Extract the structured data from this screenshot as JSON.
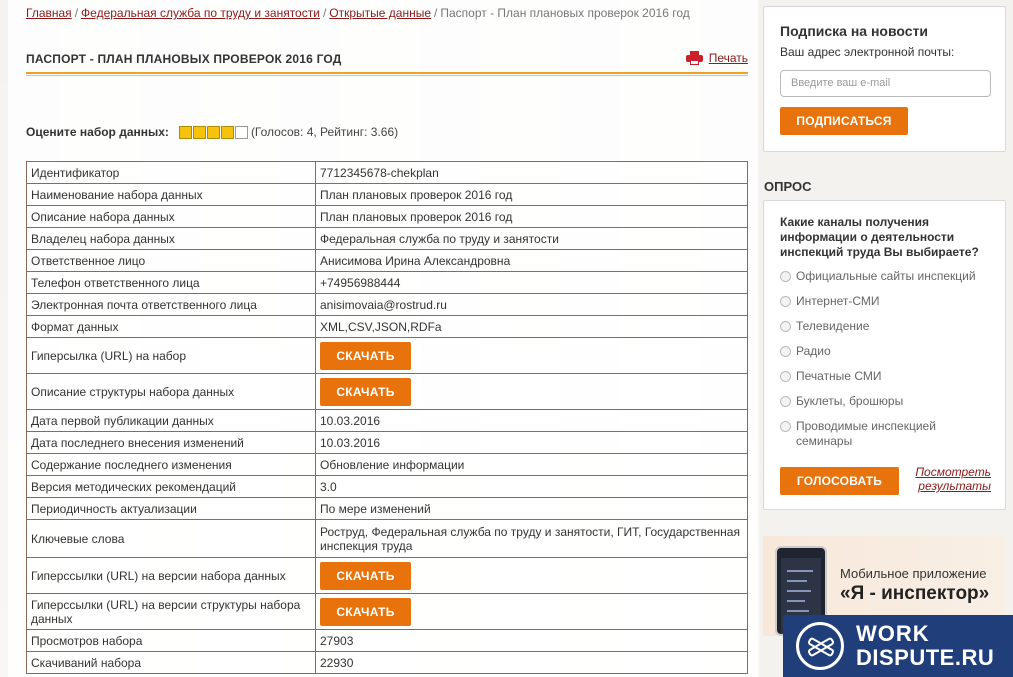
{
  "breadcrumb": {
    "items": [
      "Главная",
      "Федеральная служба по труду и занятости",
      "Открытые данные"
    ],
    "current": "Паспорт - План плановых проверок 2016 год",
    "separator": "/"
  },
  "page": {
    "title": "ПАСПОРТ - ПЛАН ПЛАНОВЫХ ПРОВЕРОК 2016 ГОД",
    "print_label": "Печать",
    "accent_color": "#e8720c"
  },
  "rating": {
    "label": "Оцените набор данных:",
    "stars_filled": 4,
    "stars_total": 5,
    "meta": "(Голосов: 4, Рейтинг: 3.66)"
  },
  "passport": {
    "rows": [
      {
        "key": "Идентификатор",
        "value": "7712345678-chekplan"
      },
      {
        "key": "Наименование набора данных",
        "value": "План плановых проверок 2016 год"
      },
      {
        "key": "Описание набора данных",
        "value": "План плановых проверок 2016 год"
      },
      {
        "key": "Владелец набора данных",
        "value": "Федеральная служба по труду и занятости"
      },
      {
        "key": "Ответственное лицо",
        "value": "Анисимова Ирина Александровна"
      },
      {
        "key": "Телефон ответственного лица",
        "value": "+74956988444"
      },
      {
        "key": "Электронная почта ответственного лица",
        "value": "anisimovaia@rostrud.ru"
      },
      {
        "key": "Формат данных",
        "value": "XML,CSV,JSON,RDFa"
      },
      {
        "key": "Гиперсылка (URL) на набор",
        "button": "СКАЧАТЬ"
      },
      {
        "key": "Описание структуры набора данных",
        "button": "СКАЧАТЬ"
      },
      {
        "key": "Дата первой публикации данных",
        "value": "10.03.2016"
      },
      {
        "key": "Дата последнего внесения изменений",
        "value": "10.03.2016"
      },
      {
        "key": "Содержание последнего изменения",
        "value": "Обновление информации"
      },
      {
        "key": "Версия методических рекомендаций",
        "value": "3.0"
      },
      {
        "key": "Периодичность актуализации",
        "value": "По мере изменений"
      },
      {
        "key": "Ключевые слова",
        "value": "Роструд, Федеральная служба по труду и занятости, ГИТ, Государственная инспекция труда"
      },
      {
        "key": "Гиперссылки (URL) на версии набора данных",
        "button": "СКАЧАТЬ"
      },
      {
        "key": "Гиперссылки (URL) на версии структуры набора данных",
        "button": "СКАЧАТЬ"
      },
      {
        "key": "Просмотров набора",
        "value": "27903"
      },
      {
        "key": "Скачиваний набора",
        "value": "22930"
      }
    ]
  },
  "subscribe": {
    "title": "Подписка на новости",
    "label": "Ваш адрес электронной почты:",
    "placeholder": "Введите ваш e-mail",
    "button": "ПОДПИСАТЬСЯ"
  },
  "poll": {
    "heading": "ОПРОС",
    "question": "Какие каналы получения информации о деятельности инспекций труда Вы выбираете?",
    "options": [
      "Официальные сайты инспекций",
      "Интернет-СМИ",
      "Телевидение",
      "Радио",
      "Печатные СМИ",
      "Буклеты, брошюры",
      "Проводимые инспекцией семинары"
    ],
    "vote_button": "ГОЛОСОВАТЬ",
    "results_link": "Посмотреть результаты"
  },
  "app_banner": {
    "line1": "Мобильное приложение",
    "line2": "«Я - инспектор»"
  },
  "watermark": {
    "line1": "WORK",
    "line2": "DISPUTE.RU"
  }
}
